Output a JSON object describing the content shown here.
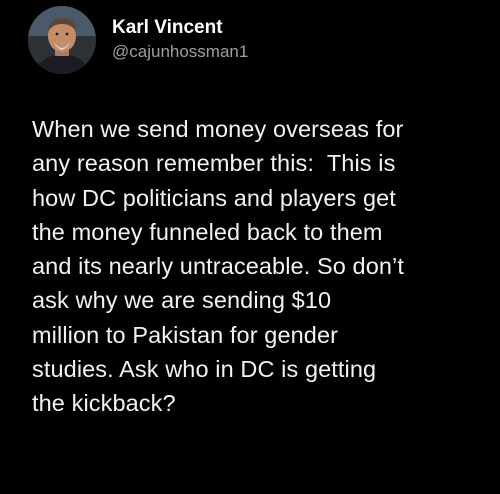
{
  "author": {
    "display_name": "Karl Vincent",
    "handle": "@cajunhossman1"
  },
  "tweet": {
    "lines": [
      "When we send money overseas for",
      "any reason remember this:  This is",
      "how DC politicians and players get",
      "the money funneled back to them",
      "and its nearly untraceable. So don’t",
      "ask why we are sending $10",
      "million to Pakistan for gender",
      "studies. Ask who in DC is getting",
      "the kickback?"
    ]
  },
  "colors": {
    "background": "#000000",
    "text": "#f2f2f2",
    "handle": "#9aa0a6"
  }
}
